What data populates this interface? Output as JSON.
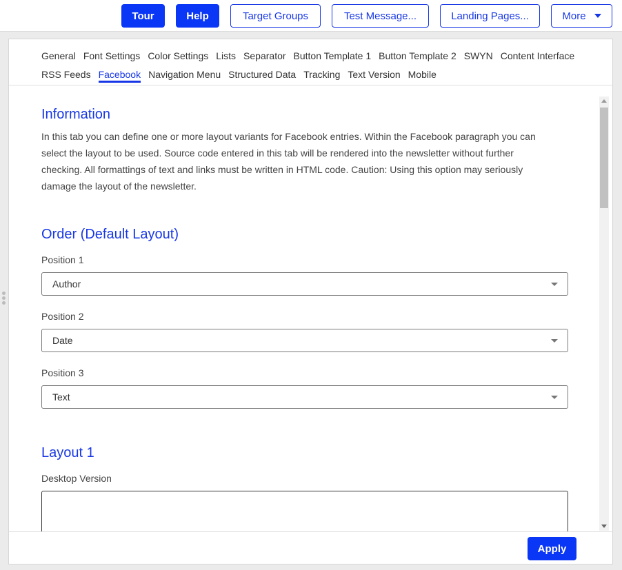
{
  "toolbar": {
    "tour_label": "Tour",
    "help_label": "Help",
    "target_groups_label": "Target Groups",
    "test_message_label": "Test Message...",
    "landing_pages_label": "Landing Pages...",
    "more_label": "More"
  },
  "tabs": {
    "row1": [
      "General",
      "Font Settings",
      "Color Settings",
      "Lists",
      "Separator",
      "Button Template 1",
      "Button Template 2",
      "SWYN",
      "Content Interface"
    ],
    "row2": [
      "RSS Feeds",
      "Facebook",
      "Navigation Menu",
      "Structured Data",
      "Tracking",
      "Text Version",
      "Mobile"
    ],
    "active": "Facebook"
  },
  "information": {
    "title": "Information",
    "lines": [
      "In this tab you can define one or more layout variants for Facebook entries. Within the Facebook paragraph you can",
      "select the layout to be used. Source code entered in this tab will be rendered into the newsletter without further",
      "checking. All formattings of text and links must be written in HTML code. Caution: Using this option may seriously",
      "damage the layout of the newsletter."
    ]
  },
  "order": {
    "title": "Order (Default Layout)",
    "position1_label": "Position 1",
    "position1_value": "Author",
    "position2_label": "Position 2",
    "position2_value": "Date",
    "position3_label": "Position 3",
    "position3_value": "Text"
  },
  "layout1": {
    "title": "Layout 1",
    "desktop_label": "Desktop Version",
    "desktop_value": ""
  },
  "footer": {
    "apply_label": "Apply"
  },
  "colors": {
    "accent": "#0a36f5",
    "link": "#1737e6"
  }
}
